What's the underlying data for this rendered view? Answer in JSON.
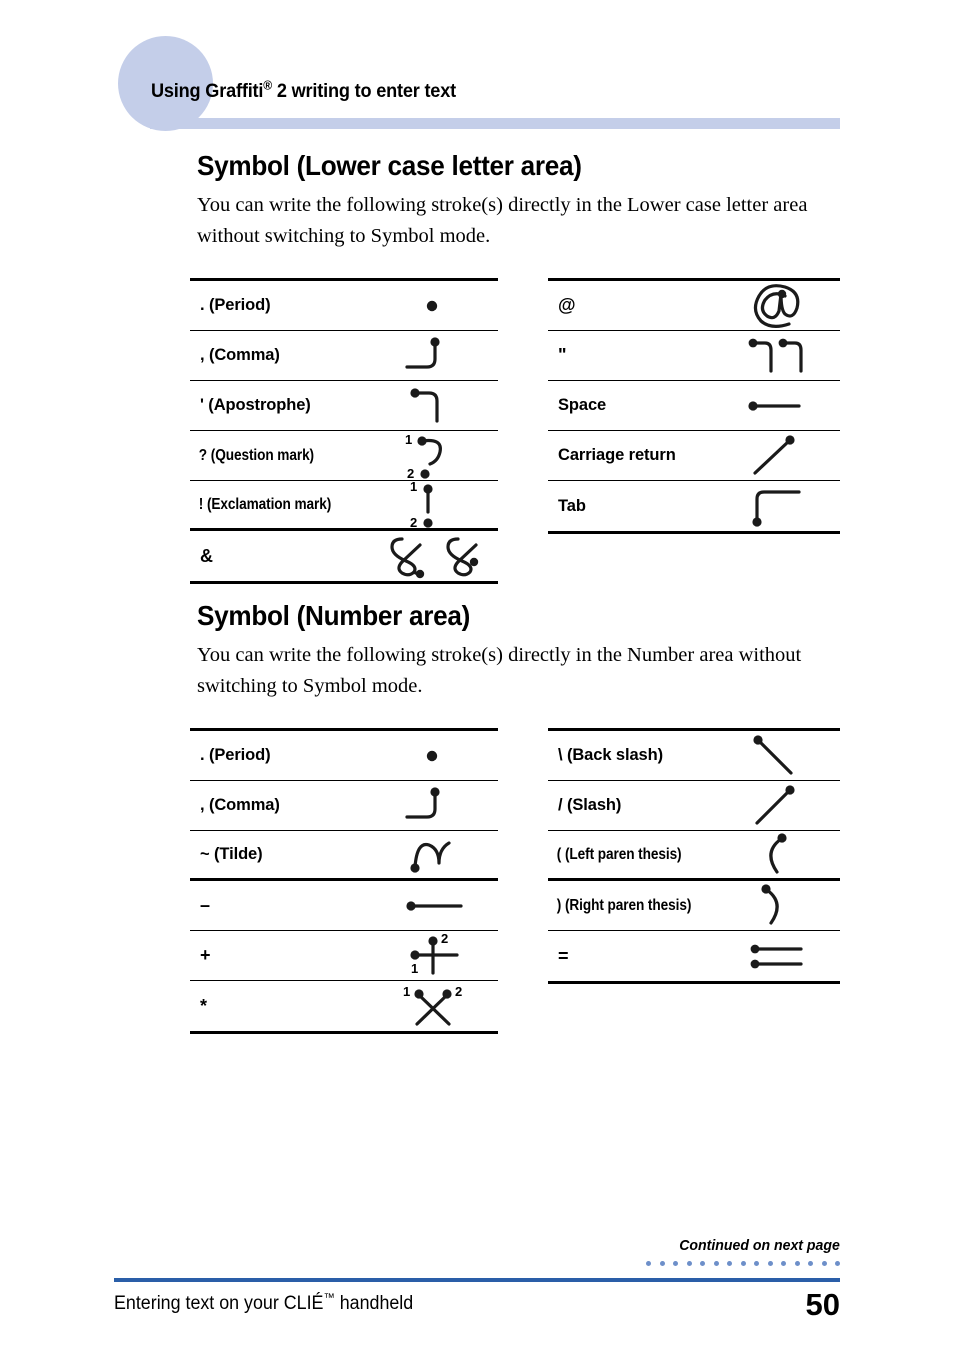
{
  "header": {
    "title_pre": "Using Graffiti",
    "title_reg": "®",
    "title_post": " 2 writing to enter text",
    "circle_color": "#c4cee9",
    "bar_color": "#c4cee9"
  },
  "sections": [
    {
      "heading": "Symbol (Lower case letter area)",
      "body": "You can write the following stroke(s) directly in the Lower case letter area without switching to Symbol mode.",
      "left_rows": [
        {
          "label": ". (Period)",
          "stroke": "period"
        },
        {
          "label": ", (Comma)",
          "stroke": "comma"
        },
        {
          "label": "' (Apostrophe)",
          "stroke": "apostrophe"
        },
        {
          "label": "? (Question mark)",
          "stroke": "question"
        },
        {
          "label": "! (Exclamation mark)",
          "stroke": "exclamation"
        },
        {
          "label": "&",
          "stroke": "ampersand"
        }
      ],
      "right_rows": [
        {
          "label": "@",
          "stroke": "at"
        },
        {
          "label": "\"",
          "stroke": "quote"
        },
        {
          "label": "Space",
          "stroke": "space"
        },
        {
          "label": "Carriage return",
          "stroke": "carriage-return"
        },
        {
          "label": "Tab",
          "stroke": "tab"
        }
      ]
    },
    {
      "heading": "Symbol (Number area)",
      "body": "You can write the following stroke(s) directly in the Number area without switching to Symbol mode.",
      "left_rows": [
        {
          "label": ". (Period)",
          "stroke": "period"
        },
        {
          "label": ", (Comma)",
          "stroke": "comma"
        },
        {
          "label": "~ (Tilde)",
          "stroke": "tilde"
        },
        {
          "label": "–",
          "stroke": "dash"
        },
        {
          "label": "+",
          "stroke": "plus"
        },
        {
          "label": "*",
          "stroke": "asterisk"
        }
      ],
      "right_rows": [
        {
          "label": "\\ (Back slash)",
          "stroke": "backslash"
        },
        {
          "label": "/ (Slash)",
          "stroke": "slash"
        },
        {
          "label": "( (Left paren thesis)",
          "stroke": "lparen"
        },
        {
          "label": ") (Right paren thesis)",
          "stroke": "rparen"
        },
        {
          "label": "=",
          "stroke": "equals"
        }
      ]
    }
  ],
  "footer": {
    "continued": "Continued on next page",
    "dot_count": 15,
    "dot_color": "#6d8fc9",
    "rule_color": "#2a5ea8",
    "text_pre": "Entering text on your CLIÉ",
    "text_tm": "™",
    "text_post": " handheld",
    "page_number": "50"
  },
  "stroke_numbers": {
    "one": "1",
    "two": "2"
  }
}
